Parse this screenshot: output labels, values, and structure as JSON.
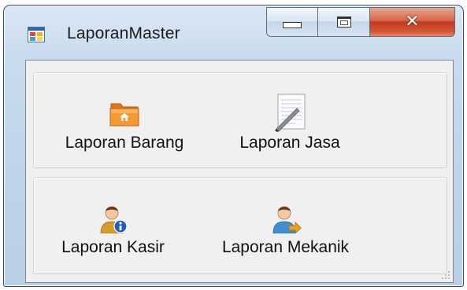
{
  "window": {
    "title": "LaporanMaster",
    "icon": "form-app-icon",
    "buttons": {
      "minimize": "minimize-icon",
      "maximize": "maximize-icon",
      "close": "close-icon"
    }
  },
  "groups": [
    {
      "items": [
        {
          "label": "Laporan Barang",
          "icon": "folder-icon",
          "color": "#f08a24"
        },
        {
          "label": "Laporan Jasa",
          "icon": "document-pen-icon",
          "color": "#d8dde4"
        }
      ]
    },
    {
      "items": [
        {
          "label": "Laporan Kasir",
          "icon": "user-info-icon",
          "color": "#1f5fbf"
        },
        {
          "label": "Laporan Mekanik",
          "icon": "user-arrow-icon",
          "color": "#f0a020"
        }
      ]
    }
  ],
  "colors": {
    "window_frame": "#bfd4ea",
    "client_bg": "#f0f0f0",
    "close_button": "#c2391e"
  }
}
